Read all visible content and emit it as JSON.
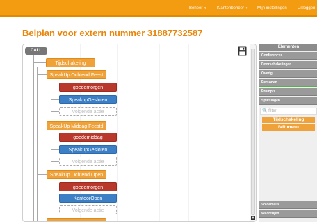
{
  "nav": {
    "items": [
      {
        "label": "Beheer",
        "caret": "▾"
      },
      {
        "label": "Klantenbeheer",
        "caret": "▾"
      },
      {
        "label": "Mijn instellingen",
        "caret": ""
      },
      {
        "label": "Uitloggen",
        "caret": ""
      }
    ]
  },
  "page": {
    "title": "Belplan voor extern nummer 31887732587"
  },
  "canvas": {
    "save_icon": "floppy-disk-icon",
    "nodes": {
      "call": "CALL",
      "tijdschakeling": "Tijdschakeling",
      "speakup_ochtend_feest": "SpeakUp Ochtend Feest",
      "goedemorgen_1": "goedemorgen",
      "speakup_gesloten_1": "SpeakupGesloten",
      "volgende_1": "Volgende actie",
      "speakup_middag_feest": "SpeakUp Middag Feestd",
      "goedemiddag": "goedemiddag",
      "speakup_gesloten_2": "SpeakupGesloten",
      "volgende_2": "Volgende actie",
      "speakup_ochtend_open": "SpeakUp Ochtend Open",
      "goedemorgen_2": "goedemorgen",
      "kantoor_open": "KantoorOpen",
      "volgende_3": "Volgende actie"
    }
  },
  "palette": {
    "header": "Elementen",
    "items": [
      "Conferences",
      "Doorschakelingen",
      "Overig",
      "Personen",
      "Prompts",
      "Splitsingen"
    ],
    "filter_placeholder": "filter",
    "filter_icon": "search-icon",
    "elements": [
      "Tijdschakeling",
      "IVR menu"
    ],
    "bottom_items": [
      "Voicemails",
      "Wachtrijen"
    ]
  },
  "colors": {
    "brand_orange": "#f39c12",
    "node_orange": "#f0a23a",
    "node_red": "#b8382c",
    "node_blue": "#3c7fc4",
    "node_gray": "#777777"
  }
}
